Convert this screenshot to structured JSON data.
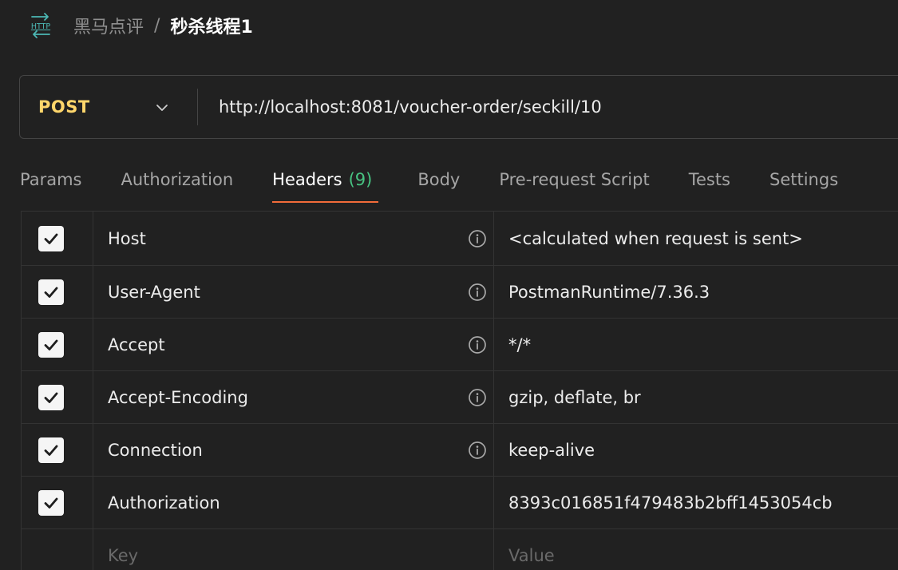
{
  "breadcrumb": {
    "icon": "http-request-icon",
    "parent": "黑马点评",
    "separator": "/",
    "current": "秒杀线程1"
  },
  "request": {
    "method": "POST",
    "url": "http://localhost:8081/voucher-order/seckill/10"
  },
  "tabs": [
    {
      "label": "Params"
    },
    {
      "label": "Authorization"
    },
    {
      "label": "Headers",
      "count": "(9)",
      "active": true
    },
    {
      "label": "Body"
    },
    {
      "label": "Pre-request Script"
    },
    {
      "label": "Tests"
    },
    {
      "label": "Settings"
    }
  ],
  "headers": [
    {
      "key": "Host",
      "value": "<calculated when request is sent>",
      "checked": true,
      "info": true
    },
    {
      "key": "User-Agent",
      "value": "PostmanRuntime/7.36.3",
      "checked": true,
      "info": true
    },
    {
      "key": "Accept",
      "value": "*/*",
      "checked": true,
      "info": true
    },
    {
      "key": "Accept-Encoding",
      "value": "gzip, deflate, br",
      "checked": true,
      "info": true
    },
    {
      "key": "Connection",
      "value": "keep-alive",
      "checked": true,
      "info": true
    },
    {
      "key": "Authorization",
      "value": "8393c016851f479483b2bff1453054cb",
      "checked": true,
      "info": false
    }
  ],
  "new_row": {
    "key_placeholder": "Key",
    "value_placeholder": "Value"
  },
  "colors": {
    "method": "#ffd66b",
    "tab_count": "#47c281",
    "active_tab_underline": "#f26b3a",
    "http_icon": "#4cb8b4"
  }
}
